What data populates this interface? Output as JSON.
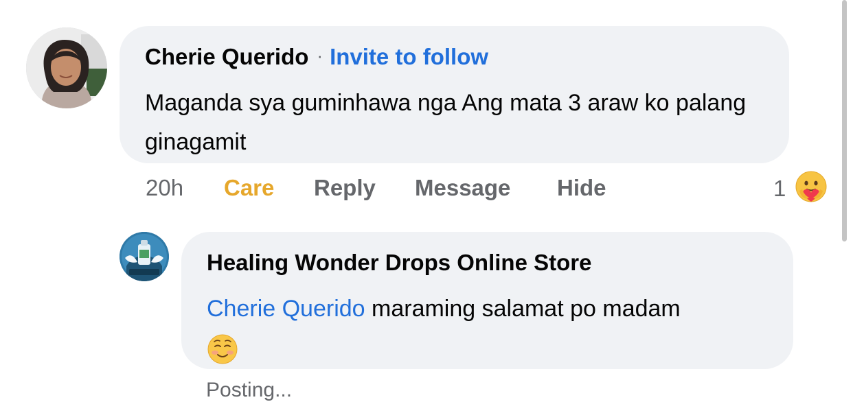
{
  "comment": {
    "author": "Cherie Querido",
    "separator": "·",
    "invite_label": "Invite to follow",
    "text": "Maganda sya guminhawa nga Ang mata 3 araw ko palang ginagamit",
    "actions": {
      "time": "20h",
      "care": "Care",
      "reply": "Reply",
      "message": "Message",
      "hide": "Hide"
    },
    "reaction": {
      "count": "1",
      "icon": "care-reaction-icon"
    }
  },
  "reply": {
    "author": "Healing Wonder Drops Online Store",
    "mention": "Cherie Querido",
    "text": " maraming salamat po madam",
    "emoji": "smiling-face-emoji",
    "status": "Posting..."
  },
  "colors": {
    "link": "#216fdb",
    "care": "#e6a72b",
    "bubble": "#f0f2f5",
    "muted": "#65676b"
  }
}
